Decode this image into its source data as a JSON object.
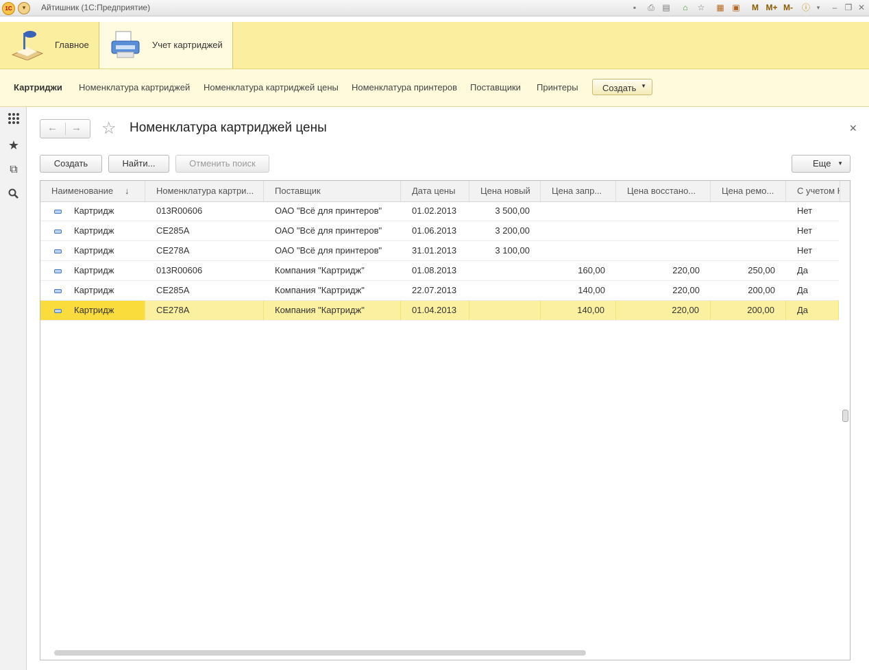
{
  "window": {
    "title": "Айтишник  (1С:Предприятие)",
    "toolbar_icons": [
      "save-icon",
      "print-icon",
      "print-preview-icon",
      "home-icon",
      "calc-icon",
      "calendar-icon"
    ],
    "memory_buttons": [
      "M",
      "M+",
      "M-"
    ]
  },
  "sections": [
    {
      "label": "Главное",
      "icon": "desk-lamp-icon"
    },
    {
      "label": "Учет картриджей",
      "icon": "printer-icon"
    }
  ],
  "functions": {
    "items": [
      "Картриджи",
      "Номенклатура картриджей",
      "Номенклатура картриджей цены",
      "Номенклатура принтеров",
      "Поставщики",
      "Принтеры"
    ],
    "create_label": "Создать"
  },
  "form": {
    "title": "Номенклатура картриджей цены",
    "buttons": {
      "create": "Создать",
      "find": "Найти...",
      "cancel_search": "Отменить поиск",
      "more": "Еще"
    }
  },
  "table": {
    "columns": [
      "Наименование",
      "Номенклатура картри...",
      "Поставщик",
      "Дата цены",
      "Цена новый",
      "Цена запр...",
      "Цена восстано...",
      "Цена ремо...",
      "С учетом Н"
    ],
    "sort_indicator": "↓",
    "rows": [
      {
        "name": "Картридж",
        "nomenclature": "013R00606",
        "supplier": "ОАО \"Всё для принтеров\"",
        "date": "01.02.2013",
        "price_new": "3 500,00",
        "price_refill": "",
        "price_restore": "",
        "price_repair": "",
        "vat": "Нет"
      },
      {
        "name": "Картридж",
        "nomenclature": "CE285A",
        "supplier": "ОАО \"Всё для принтеров\"",
        "date": "01.06.2013",
        "price_new": "3 200,00",
        "price_refill": "",
        "price_restore": "",
        "price_repair": "",
        "vat": "Нет"
      },
      {
        "name": "Картридж",
        "nomenclature": "CE278A",
        "supplier": "ОАО \"Всё для принтеров\"",
        "date": "31.01.2013",
        "price_new": "3 100,00",
        "price_refill": "",
        "price_restore": "",
        "price_repair": "",
        "vat": "Нет"
      },
      {
        "name": "Картридж",
        "nomenclature": "013R00606",
        "supplier": "Компания \"Картридж\"",
        "date": "01.08.2013",
        "price_new": "",
        "price_refill": "160,00",
        "price_restore": "220,00",
        "price_repair": "250,00",
        "vat": "Да"
      },
      {
        "name": "Картридж",
        "nomenclature": "CE285A",
        "supplier": "Компания \"Картридж\"",
        "date": "22.07.2013",
        "price_new": "",
        "price_refill": "140,00",
        "price_restore": "220,00",
        "price_repair": "200,00",
        "vat": "Да"
      },
      {
        "name": "Картридж",
        "nomenclature": "CE278A",
        "supplier": "Компания \"Картридж\"",
        "date": "01.04.2013",
        "price_new": "",
        "price_refill": "140,00",
        "price_restore": "220,00",
        "price_repair": "200,00",
        "vat": "Да",
        "selected": true
      }
    ]
  },
  "colors": {
    "section_bg": "#fcee9f",
    "selected_row": "#faf0a0",
    "selected_cell": "#fadd3c"
  }
}
